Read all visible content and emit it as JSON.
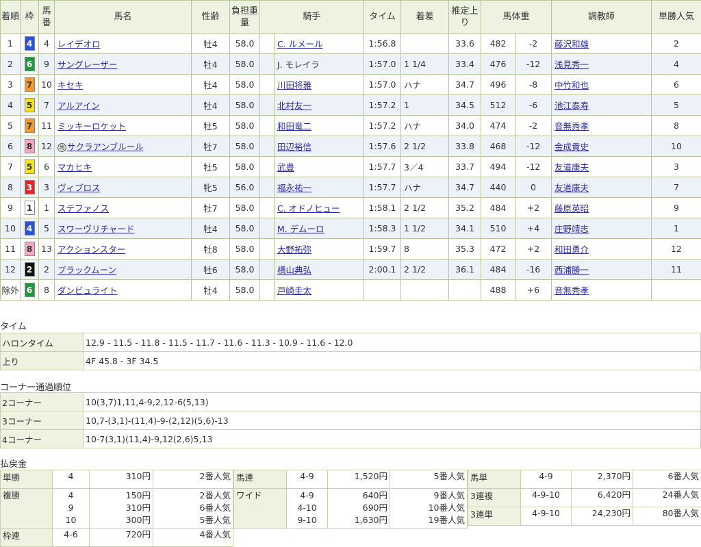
{
  "headers": {
    "rank": "着順",
    "waku": "枠",
    "num": "馬番",
    "horse": "馬名",
    "sexage": "性齢",
    "weight": "負担重量",
    "jockey": "騎手",
    "time": "タイム",
    "margin": "着差",
    "last3f": "推定上り",
    "bodyweight": "馬体重",
    "trainer": "調教師",
    "odds_pop": "単勝人気"
  },
  "rows": [
    {
      "rank": "1",
      "waku": "4",
      "num": "4",
      "horse": "レイデオロ",
      "chi": "",
      "sexage": "牡4",
      "weight": "58.0",
      "jockey": "C. ルメール",
      "jockey_link": true,
      "time": "1:56.8",
      "margin": "",
      "last3f": "33.6",
      "bw": "482",
      "bwd": "-2",
      "trainer": "藤沢和雄",
      "pop": "2"
    },
    {
      "rank": "2",
      "waku": "6",
      "num": "9",
      "horse": "サングレーザー",
      "chi": "",
      "sexage": "牡4",
      "weight": "58.0",
      "jockey": "J. モレイラ",
      "jockey_link": false,
      "time": "1:57.0",
      "margin": "1 1/4",
      "last3f": "33.4",
      "bw": "476",
      "bwd": "-12",
      "trainer": "浅見秀一",
      "pop": "4"
    },
    {
      "rank": "3",
      "waku": "7",
      "num": "10",
      "horse": "キセキ",
      "chi": "",
      "sexage": "牡4",
      "weight": "58.0",
      "jockey": "川田将雅",
      "jockey_link": true,
      "time": "1:57.0",
      "margin": "ハナ",
      "last3f": "34.7",
      "bw": "496",
      "bwd": "-8",
      "trainer": "中竹和也",
      "pop": "6"
    },
    {
      "rank": "4",
      "waku": "5",
      "num": "7",
      "horse": "アルアイン",
      "chi": "",
      "sexage": "牡4",
      "weight": "58.0",
      "jockey": "北村友一",
      "jockey_link": true,
      "time": "1:57.2",
      "margin": "1",
      "last3f": "34.5",
      "bw": "512",
      "bwd": "-6",
      "trainer": "池江泰寿",
      "pop": "5"
    },
    {
      "rank": "5",
      "waku": "7",
      "num": "11",
      "horse": "ミッキーロケット",
      "chi": "",
      "sexage": "牡5",
      "weight": "58.0",
      "jockey": "和田竜二",
      "jockey_link": true,
      "time": "1:57.2",
      "margin": "ハナ",
      "last3f": "34.0",
      "bw": "474",
      "bwd": "-2",
      "trainer": "音無秀孝",
      "pop": "8"
    },
    {
      "rank": "6",
      "waku": "8",
      "num": "12",
      "horse": "サクラアンブルール",
      "chi": "地",
      "sexage": "牡7",
      "weight": "58.0",
      "jockey": "田辺裕信",
      "jockey_link": true,
      "time": "1:57.6",
      "margin": "2 1/2",
      "last3f": "33.8",
      "bw": "468",
      "bwd": "-12",
      "trainer": "金成貴史",
      "pop": "10"
    },
    {
      "rank": "7",
      "waku": "5",
      "num": "6",
      "horse": "マカヒキ",
      "chi": "",
      "sexage": "牡5",
      "weight": "58.0",
      "jockey": "武豊",
      "jockey_link": true,
      "time": "1:57.7",
      "margin": "3／4",
      "last3f": "33.7",
      "bw": "494",
      "bwd": "-12",
      "trainer": "友道康夫",
      "pop": "3"
    },
    {
      "rank": "8",
      "waku": "3",
      "num": "3",
      "horse": "ヴィブロス",
      "chi": "",
      "sexage": "牝5",
      "weight": "56.0",
      "jockey": "福永祐一",
      "jockey_link": true,
      "time": "1:57.7",
      "margin": "ハナ",
      "last3f": "34.7",
      "bw": "440",
      "bwd": "0",
      "trainer": "友道康夫",
      "pop": "7"
    },
    {
      "rank": "9",
      "waku": "1",
      "num": "1",
      "horse": "ステファノス",
      "chi": "",
      "sexage": "牡7",
      "weight": "58.0",
      "jockey": "C. オドノヒュー",
      "jockey_link": true,
      "time": "1:58.1",
      "margin": "2 1/2",
      "last3f": "35.2",
      "bw": "484",
      "bwd": "+2",
      "trainer": "藤原英昭",
      "pop": "9"
    },
    {
      "rank": "10",
      "waku": "4",
      "num": "5",
      "horse": "スワーヴリチャード",
      "chi": "",
      "sexage": "牡4",
      "weight": "58.0",
      "jockey": "M. デムーロ",
      "jockey_link": true,
      "time": "1:58.3",
      "margin": "1 1/2",
      "last3f": "34.1",
      "bw": "510",
      "bwd": "+4",
      "trainer": "庄野靖志",
      "pop": "1"
    },
    {
      "rank": "11",
      "waku": "8",
      "num": "13",
      "horse": "アクションスター",
      "chi": "",
      "sexage": "牡8",
      "weight": "58.0",
      "jockey": "大野拓弥",
      "jockey_link": true,
      "time": "1:59.7",
      "margin": "8",
      "last3f": "35.3",
      "bw": "472",
      "bwd": "+2",
      "trainer": "和田勇介",
      "pop": "12"
    },
    {
      "rank": "12",
      "waku": "2",
      "num": "2",
      "horse": "ブラックムーン",
      "chi": "",
      "sexage": "牡6",
      "weight": "58.0",
      "jockey": "横山典弘",
      "jockey_link": true,
      "time": "2:00.1",
      "margin": "2 1/2",
      "last3f": "36.1",
      "bw": "484",
      "bwd": "-16",
      "trainer": "西浦勝一",
      "pop": "11"
    },
    {
      "rank": "除外",
      "waku": "6",
      "num": "8",
      "horse": "ダンビュライト",
      "chi": "",
      "sexage": "牡4",
      "weight": "58.0",
      "jockey": "戸崎圭太",
      "jockey_link": true,
      "time": "",
      "margin": "",
      "last3f": "",
      "bw": "488",
      "bwd": "+6",
      "trainer": "音無秀孝",
      "pop": ""
    }
  ],
  "waku_colors": {
    "1": {
      "bg": "#ffffff",
      "fg": "#333333"
    },
    "2": {
      "bg": "#111111",
      "fg": "#ffffff"
    },
    "3": {
      "bg": "#e8262a",
      "fg": "#ffffff"
    },
    "4": {
      "bg": "#2a52d8",
      "fg": "#ffffff"
    },
    "5": {
      "bg": "#f5e51a",
      "fg": "#333333"
    },
    "6": {
      "bg": "#1e9a3a",
      "fg": "#ffffff"
    },
    "7": {
      "bg": "#f59a2a",
      "fg": "#333333"
    },
    "8": {
      "bg": "#f5a8c0",
      "fg": "#333333"
    }
  },
  "time_section": {
    "title": "タイム",
    "furlong_label": "ハロンタイム",
    "furlong_value": "12.9 - 11.5 - 11.8 - 11.5 - 11.7 - 11.6 - 11.3 - 10.9 - 11.6 - 12.0",
    "agari_label": "上り",
    "agari_value": "4F 45.8 - 3F 34.5"
  },
  "corner_section": {
    "title": "コーナー通過順位",
    "corners": [
      {
        "label": "2コーナー",
        "value": "10(3,7)1,11,4-9,2,12-6(5,13)"
      },
      {
        "label": "3コーナー",
        "value": "10,7-(3,1)-(11,4)-9-(2,12)(5,6)-13"
      },
      {
        "label": "4コーナー",
        "value": "10-7(3,1)(11,4)-9,12(2,6)5,13"
      }
    ]
  },
  "payout": {
    "title": "払戻金",
    "tansho": {
      "label": "単勝",
      "num": "4",
      "amt": "310円",
      "pop": "2番人気"
    },
    "fukusho": {
      "label": "複勝",
      "nums": [
        "4",
        "9",
        "10"
      ],
      "amts": [
        "150円",
        "310円",
        "300円"
      ],
      "pops": [
        "2番人気",
        "6番人気",
        "5番人気"
      ]
    },
    "wakuren": {
      "label": "枠連",
      "num": "4-6",
      "amt": "720円",
      "pop": "4番人気"
    },
    "umaren": {
      "label": "馬連",
      "num": "4-9",
      "amt": "1,520円",
      "pop": "5番人気"
    },
    "wide": {
      "label": "ワイド",
      "nums": [
        "4-9",
        "4-10",
        "9-10"
      ],
      "amts": [
        "640円",
        "690円",
        "1,630円"
      ],
      "pops": [
        "9番人気",
        "10番人気",
        "19番人気"
      ]
    },
    "umatan": {
      "label": "馬単",
      "num": "4-9",
      "amt": "2,370円",
      "pop": "6番人気"
    },
    "sanrenpuku": {
      "label": "3連複",
      "num": "4-9-10",
      "amt": "6,420円",
      "pop": "24番人気"
    },
    "sanrentan": {
      "label": "3連単",
      "num": "4-9-10",
      "amt": "24,230円",
      "pop": "80番人気"
    }
  }
}
